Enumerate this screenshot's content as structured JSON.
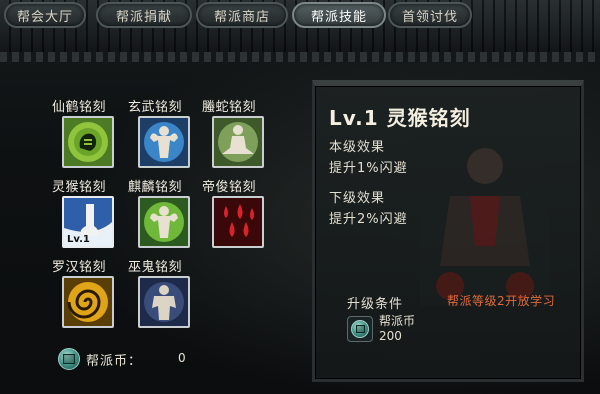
{
  "tabs": [
    {
      "label": "帮会大厅",
      "active": false
    },
    {
      "label": "帮派捐献",
      "active": false
    },
    {
      "label": "帮派商店",
      "active": false
    },
    {
      "label": "帮派技能",
      "active": true
    },
    {
      "label": "首领讨伐",
      "active": false
    }
  ],
  "skills": [
    {
      "name": "仙鹤铭刻",
      "icon": "crane-fist-icon",
      "level": ""
    },
    {
      "name": "玄武铭刻",
      "icon": "muscle-flex-icon",
      "level": ""
    },
    {
      "name": "螣蛇铭刻",
      "icon": "meditation-icon",
      "level": ""
    },
    {
      "name": "灵猴铭刻",
      "icon": "foot-icon",
      "level": "Lv.1"
    },
    {
      "name": "麒麟铭刻",
      "icon": "muscle-flex-icon",
      "level": ""
    },
    {
      "name": "帝俊铭刻",
      "icon": "blood-drops-icon",
      "level": ""
    },
    {
      "name": "罗汉铭刻",
      "icon": "spiral-icon",
      "level": ""
    },
    {
      "name": "巫鬼铭刻",
      "icon": "muscle-man-icon",
      "level": ""
    }
  ],
  "currency": {
    "label": "帮派币：",
    "value": "0",
    "icon": "guild-coin-icon"
  },
  "detail": {
    "level": "Lv.1",
    "name": "灵猴铭刻",
    "current_label": "本级效果",
    "current_effect": "提升1%闪避",
    "next_label": "下级效果",
    "next_effect": "提升2%闪避",
    "upgrade_label": "升级条件",
    "upgrade_condition": "帮派等级2开放学习",
    "cost_name": "帮派币",
    "cost_value": "200"
  },
  "colors": {
    "condition": "#e06a3c",
    "active_tab": "#556063"
  }
}
